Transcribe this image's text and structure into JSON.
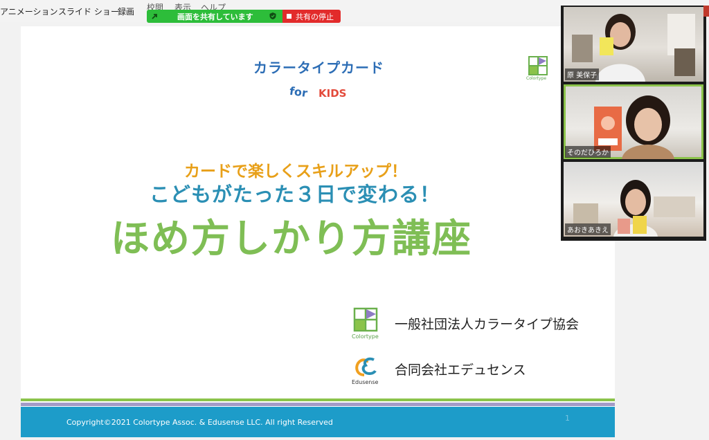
{
  "menu": {
    "items": [
      "アニメーション",
      "スライド ショー",
      "録画",
      "校閲",
      "表示",
      "ヘルプ"
    ]
  },
  "share_banner": {
    "label": "画面を共有しています",
    "stop_label": "共有の停止"
  },
  "slide": {
    "logo_title": "カラータイプカード",
    "logo_for": "for",
    "logo_kids": "KIDS",
    "small_logo_label": "Colortype",
    "subtitle1": "カードで楽しくスキルアップ！",
    "subtitle2": "こどもがたった３日で変わる！",
    "main_title": "ほめ方しかり方講座",
    "org1_logo_label": "Colortype",
    "org1_name": "一般社団法人カラータイプ協会",
    "org2_logo_label": "Edusense",
    "org2_name": "合同会社エデュセンス",
    "footer_copyright": "Copyright©2021 Colortype Assoc. & Edusense LLC. All right Reserved",
    "page_number": "1"
  },
  "participants": [
    {
      "name": "原 美保子"
    },
    {
      "name": "そのだひろか"
    },
    {
      "name": "あおきあきえ"
    }
  ],
  "colors": {
    "share_green": "#2dbd3a",
    "stop_red": "#e22b2b",
    "title_green": "#7fbe55",
    "subtitle_orange": "#e8a019",
    "subtitle_blue": "#2b8fb4",
    "footer_blue": "#1d9cc9"
  }
}
